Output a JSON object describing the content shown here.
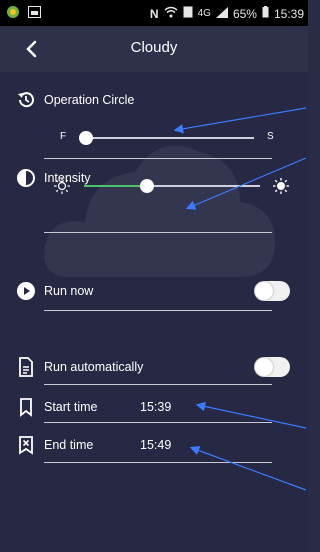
{
  "status_bar": {
    "network": "4G",
    "battery": "65%",
    "time": "15:39"
  },
  "app_bar": {
    "title": "Cloudy",
    "back_icon": "chevron-left-icon"
  },
  "operation_circle": {
    "label": "Operation Circle",
    "icon": "history-icon",
    "min_label": "F",
    "max_label": "S",
    "value_fraction": 0.0
  },
  "intensity": {
    "label": "Intensity",
    "icon": "contrast-icon",
    "min_icon": "sun-outline-icon",
    "max_icon": "sun-filled-icon",
    "value_fraction": 0.36
  },
  "run_now": {
    "label": "Run now",
    "icon": "play-circle-icon",
    "enabled": false
  },
  "run_automatically": {
    "label": "Run automatically",
    "icon": "document-icon",
    "enabled": false
  },
  "start_time": {
    "label": "Start time",
    "value": "15:39",
    "icon": "bookmark-icon"
  },
  "end_time": {
    "label": "End time",
    "value": "15:49",
    "icon": "bookmark-x-icon"
  },
  "colors": {
    "background": "#262844",
    "accent_green": "#4fc36b",
    "annotation_blue": "#3a7bff"
  }
}
